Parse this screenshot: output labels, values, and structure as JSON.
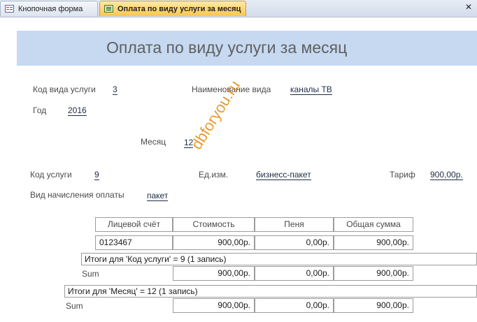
{
  "tabs": [
    {
      "label": "Кнопочная форма",
      "icon": "form-icon"
    },
    {
      "label": "Оплата по виду услуги за месяц",
      "icon": "report-icon",
      "active": true
    }
  ],
  "close_symbol": "✕",
  "report": {
    "title": "Оплата по виду услуги за месяц",
    "fields": {
      "kod_vida_label": "Код вида услуги",
      "kod_vida_value": "3",
      "naim_vida_label": "Наименование вида",
      "naim_vida_value": "каналы ТВ",
      "god_label": "Год",
      "god_value": "2016",
      "mesyac_label": "Месяц",
      "mesyac_value": "12",
      "kod_uslugi_label": "Код услуги",
      "kod_uslugi_value": "9",
      "ed_izm_label": "Ед.изм.",
      "ed_izm_value": "бизнесс-пакет",
      "tarif_label": "Тариф",
      "tarif_value": "900,00р.",
      "vid_nach_label": "Вид начисления оплаты",
      "vid_nach_value": "пакет"
    },
    "table": {
      "columns": [
        "Лицевой счёт",
        "Стоимость",
        "Пеня",
        "Общая сумма"
      ],
      "rows": [
        [
          "0123467",
          "900,00р.",
          "0,00р.",
          "900,00р."
        ]
      ]
    },
    "group_uslugi": {
      "caption": "Итоги для 'Код услуги' =  9 (1 запись)",
      "sum_label": "Sum",
      "values": [
        "900,00р.",
        "0,00р.",
        "900,00р."
      ]
    },
    "group_mesyac": {
      "caption": "Итоги для 'Месяц' = 12 (1 запись)",
      "sum_label": "Sum",
      "values": [
        "900,00р.",
        "0,00р.",
        "900,00р."
      ]
    }
  },
  "watermark": "dbforyou.ru",
  "colors": {
    "header_band": "#c6d9f1",
    "active_tab": "#f9c64e",
    "watermark": "#e38a10"
  }
}
